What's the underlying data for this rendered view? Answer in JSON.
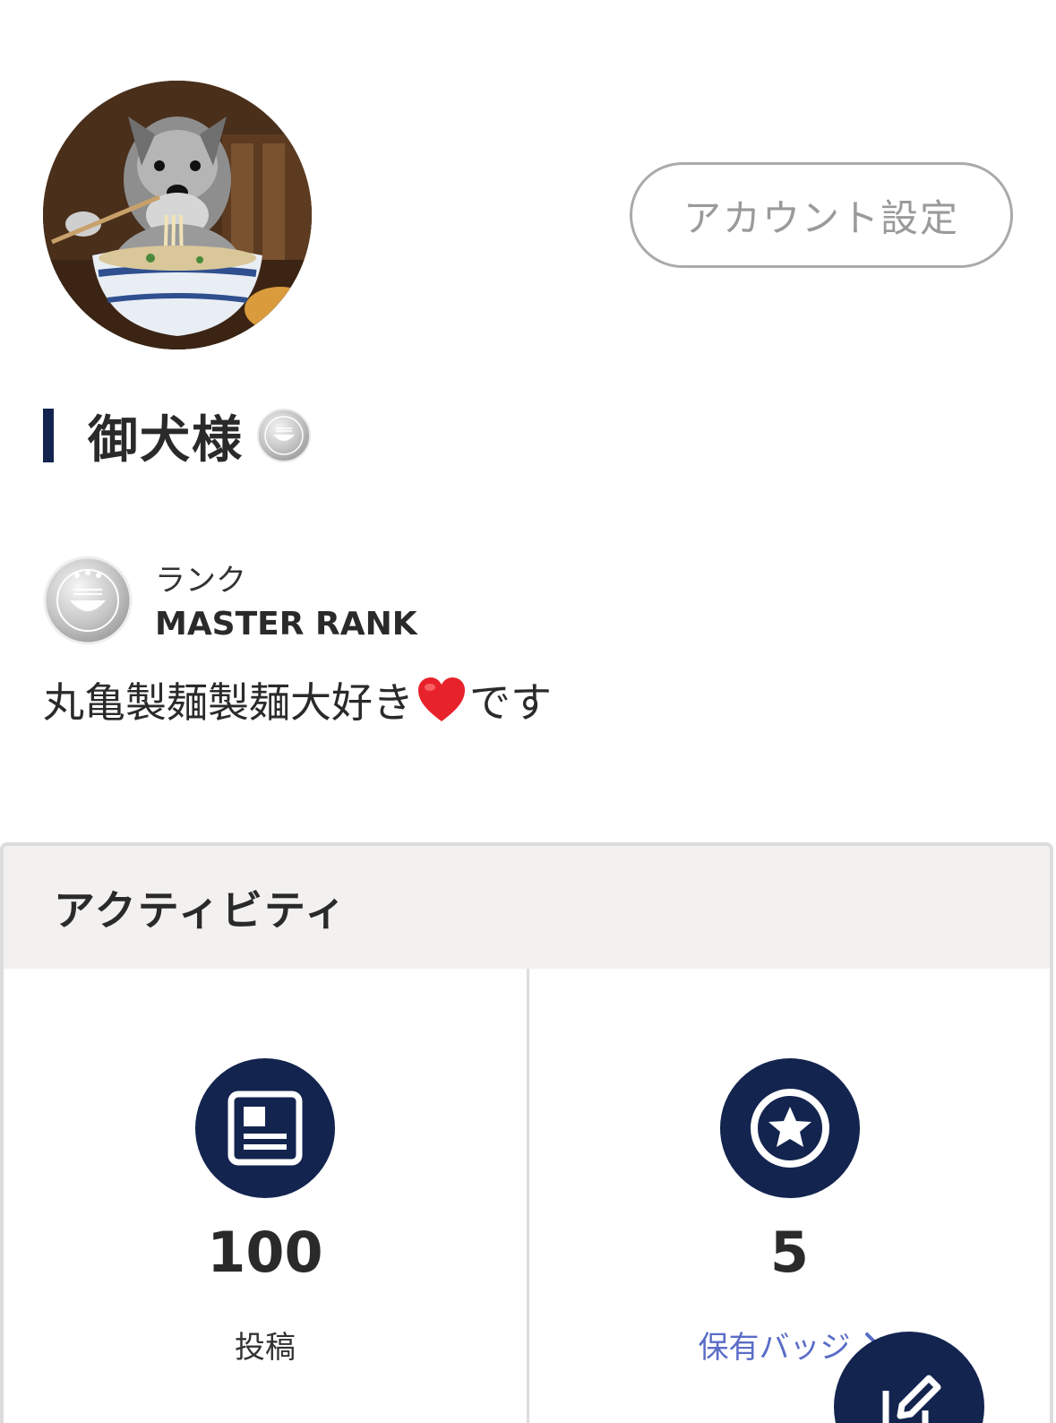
{
  "profile": {
    "account_settings_label": "アカウント設定",
    "display_name": "御犬様",
    "rank_label": "ランク",
    "rank_value": "MASTER RANK",
    "bio_before": "丸亀製麺製麺大好き",
    "bio_after": "です"
  },
  "activity": {
    "title": "アクティビティ",
    "stats": [
      {
        "value": "100",
        "label": "投稿",
        "icon": "article-icon"
      },
      {
        "value": "5",
        "label": "保有バッジ",
        "icon": "star-badge-icon"
      }
    ]
  },
  "colors": {
    "navy": "#13244f",
    "link": "#5a6dc7",
    "header_bg": "#f2f1ef"
  }
}
